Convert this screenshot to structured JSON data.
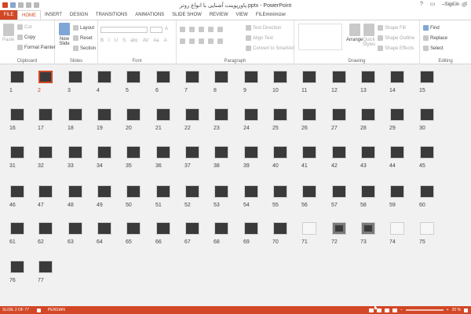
{
  "window": {
    "title": "پاورپوینت آشنایی با انواع روتر.pptx - PowerPoint",
    "signin": "Sign in"
  },
  "tabs": [
    "FILE",
    "HOME",
    "INSERT",
    "DESIGN",
    "TRANSITIONS",
    "ANIMATIONS",
    "SLIDE SHOW",
    "REVIEW",
    "VIEW",
    "FILEminimizer"
  ],
  "active_tab": "HOME",
  "ribbon": {
    "clipboard": {
      "label": "Clipboard",
      "paste": "Paste",
      "cut": "Cut",
      "copy": "Copy",
      "format_painter": "Format Painter"
    },
    "slides": {
      "label": "Slides",
      "new_slide": "New Slide",
      "layout": "Layout",
      "reset": "Reset",
      "section": "Section"
    },
    "font": {
      "label": "Font"
    },
    "paragraph": {
      "label": "Paragraph",
      "text_direction": "Text Direction",
      "align_text": "Align Text",
      "convert_smartart": "Convert to SmartArt"
    },
    "drawing": {
      "label": "Drawing",
      "arrange": "Arrange",
      "quick_styles": "Quick Styles",
      "shape_fill": "Shape Fill",
      "shape_outline": "Shape Outline",
      "shape_effects": "Shape Effects"
    },
    "editing": {
      "label": "Editing",
      "find": "Find",
      "replace": "Replace",
      "select": "Select"
    }
  },
  "slides": {
    "selected": 2,
    "white_slides": [
      71,
      74,
      75
    ],
    "rim_slides": [
      72,
      73
    ],
    "labels": [
      "1",
      "2",
      "3",
      "4",
      "5",
      "6",
      "7",
      "8",
      "9",
      "10",
      "11",
      "12",
      "13",
      "14",
      "15",
      "16",
      "17",
      "18",
      "19",
      "20",
      "21",
      "22",
      "23",
      "24",
      "25",
      "26",
      "27",
      "28",
      "29",
      "30",
      "31",
      "32",
      "33",
      "34",
      "35",
      "36",
      "37",
      "38",
      "39",
      "40",
      "41",
      "42",
      "43",
      "44",
      "45",
      "46",
      "47",
      "48",
      "49",
      "50",
      "51",
      "52",
      "53",
      "54",
      "55",
      "56",
      "57",
      "58",
      "59",
      "60",
      "61",
      "62",
      "63",
      "64",
      "65",
      "66",
      "67",
      "68",
      "69",
      "70",
      "71",
      "72",
      "73",
      "74",
      "75",
      "76",
      "77"
    ]
  },
  "status": {
    "slide": "SLIDE 2 OF 77",
    "language": "PERSIAN",
    "zoom": "20 %",
    "zoom_minus": "–",
    "zoom_plus": "+"
  },
  "colors": {
    "accent": "#d24726"
  }
}
